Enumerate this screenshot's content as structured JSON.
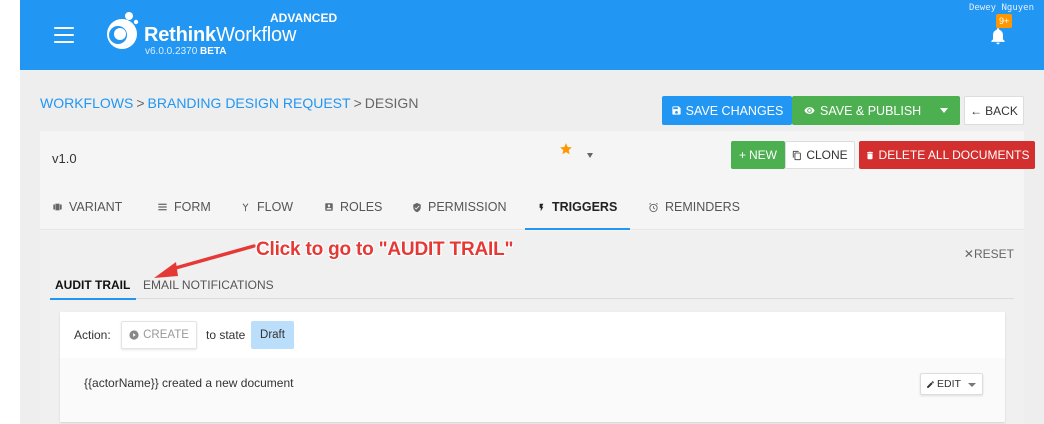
{
  "header": {
    "brand_strong": "Rethink",
    "brand_light": "Workflow",
    "version": "v6.0.0.2370",
    "version_tag": "BETA",
    "edition": "ADVANCED",
    "user_name": "Dewey Nguyen",
    "notification_count": "9+"
  },
  "breadcrumb": {
    "items": [
      "WORKFLOWS",
      "BRANDING DESIGN REQUEST",
      "DESIGN"
    ],
    "separator": ">"
  },
  "toolbar": {
    "save_label": "SAVE CHANGES",
    "publish_label": "SAVE & PUBLISH",
    "back_label": "BACK"
  },
  "version_bar": {
    "version": "v1.0",
    "new_label": "NEW",
    "clone_label": "CLONE",
    "delete_label": "DELETE ALL DOCUMENTS"
  },
  "tabs": [
    {
      "label": "VARIANT",
      "icon": "variant-icon"
    },
    {
      "label": "FORM",
      "icon": "form-icon"
    },
    {
      "label": "FLOW",
      "icon": "flow-icon"
    },
    {
      "label": "ROLES",
      "icon": "roles-icon"
    },
    {
      "label": "PERMISSION",
      "icon": "shield-icon"
    },
    {
      "label": "TRIGGERS",
      "icon": "bolt-icon",
      "active": true
    },
    {
      "label": "REMINDERS",
      "icon": "alarm-icon"
    }
  ],
  "triggers": {
    "reset_label": "RESET",
    "subtabs": [
      {
        "label": "AUDIT TRAIL",
        "active": true
      },
      {
        "label": "EMAIL NOTIFICATIONS"
      }
    ],
    "action_label": "Action:",
    "action_value": "CREATE",
    "to_state_label": "to state",
    "state_value": "Draft",
    "message": "{{actorName}} created a new document",
    "edit_label": "EDIT"
  },
  "annotation": {
    "text": "Click to go to \"AUDIT TRAIL\"",
    "color": "#e53935"
  },
  "colors": {
    "primary": "#2196f3",
    "success": "#4caf50",
    "danger": "#d32f2f",
    "badge": "#ff9800",
    "state_chip": "#bbdefb"
  }
}
